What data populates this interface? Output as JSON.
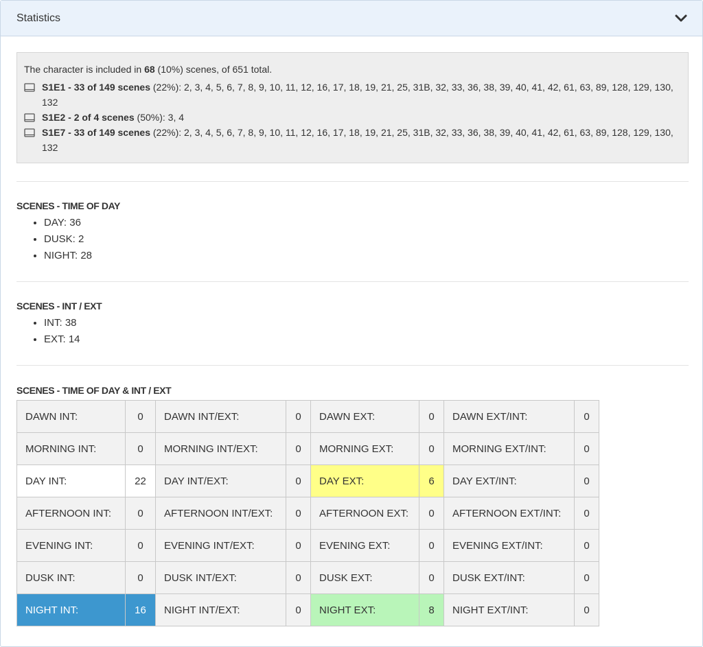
{
  "panel": {
    "title": "Statistics",
    "collapse_icon": "chevron-down-icon"
  },
  "summary": {
    "prefix": "The character is included in ",
    "count": "68",
    "suffix": " (10%) scenes, of 651 total.",
    "episodes": [
      {
        "icon": "book-icon",
        "label": "S1E1 - 33 of 149 scenes",
        "rest": " (22%): 2, 3, 4, 5, 6, 7, 8, 9, 10, 11, 12, 16, 17, 18, 19, 21, 25, 31B, 32, 33, 36, 38, 39, 40, 41, 42, 61, 63, 89, 128, 129, 130, 132"
      },
      {
        "icon": "book-icon",
        "label": "S1E2 - 2 of 4 scenes",
        "rest": " (50%): 3, 4"
      },
      {
        "icon": "book-icon",
        "label": "S1E7 - 33 of 149 scenes",
        "rest": " (22%): 2, 3, 4, 5, 6, 7, 8, 9, 10, 11, 12, 16, 17, 18, 19, 21, 25, 31B, 32, 33, 36, 38, 39, 40, 41, 42, 61, 63, 89, 128, 129, 130, 132"
      }
    ]
  },
  "time_of_day": {
    "title": "SCENES - TIME OF DAY",
    "items": [
      "DAY: 36",
      "DUSK: 2",
      "NIGHT: 28"
    ]
  },
  "int_ext": {
    "title": "SCENES - INT / EXT",
    "items": [
      "INT: 38",
      "EXT: 14"
    ]
  },
  "matrix": {
    "title": "SCENES - TIME OF DAY & INT / EXT",
    "rows": [
      [
        [
          "DAWN INT:",
          "0",
          ""
        ],
        [
          "DAWN INT/EXT:",
          "0",
          ""
        ],
        [
          "DAWN EXT:",
          "0",
          ""
        ],
        [
          "DAWN EXT/INT:",
          "0",
          ""
        ]
      ],
      [
        [
          "MORNING INT:",
          "0",
          ""
        ],
        [
          "MORNING INT/EXT:",
          "0",
          ""
        ],
        [
          "MORNING EXT:",
          "0",
          ""
        ],
        [
          "MORNING EXT/INT:",
          "0",
          ""
        ]
      ],
      [
        [
          "DAY INT:",
          "22",
          "white"
        ],
        [
          "DAY INT/EXT:",
          "0",
          ""
        ],
        [
          "DAY EXT:",
          "6",
          "yellow"
        ],
        [
          "DAY EXT/INT:",
          "0",
          ""
        ]
      ],
      [
        [
          "AFTERNOON INT:",
          "0",
          ""
        ],
        [
          "AFTERNOON INT/EXT:",
          "0",
          ""
        ],
        [
          "AFTERNOON EXT:",
          "0",
          ""
        ],
        [
          "AFTERNOON EXT/INT:",
          "0",
          ""
        ]
      ],
      [
        [
          "EVENING INT:",
          "0",
          ""
        ],
        [
          "EVENING INT/EXT:",
          "0",
          ""
        ],
        [
          "EVENING EXT:",
          "0",
          ""
        ],
        [
          "EVENING EXT/INT:",
          "0",
          ""
        ]
      ],
      [
        [
          "DUSK INT:",
          "0",
          ""
        ],
        [
          "DUSK INT/EXT:",
          "0",
          ""
        ],
        [
          "DUSK EXT:",
          "0",
          ""
        ],
        [
          "DUSK EXT/INT:",
          "0",
          ""
        ]
      ],
      [
        [
          "NIGHT INT:",
          "16",
          "blue"
        ],
        [
          "NIGHT INT/EXT:",
          "0",
          ""
        ],
        [
          "NIGHT EXT:",
          "8",
          "green"
        ],
        [
          "NIGHT EXT/INT:",
          "0",
          ""
        ]
      ]
    ]
  },
  "colors": {
    "header_bg": "#eaf2fb",
    "highlight_white": "#ffffff",
    "highlight_yellow": "#ffff88",
    "highlight_blue": "#3d97cf",
    "highlight_green": "#b9f5b9"
  }
}
